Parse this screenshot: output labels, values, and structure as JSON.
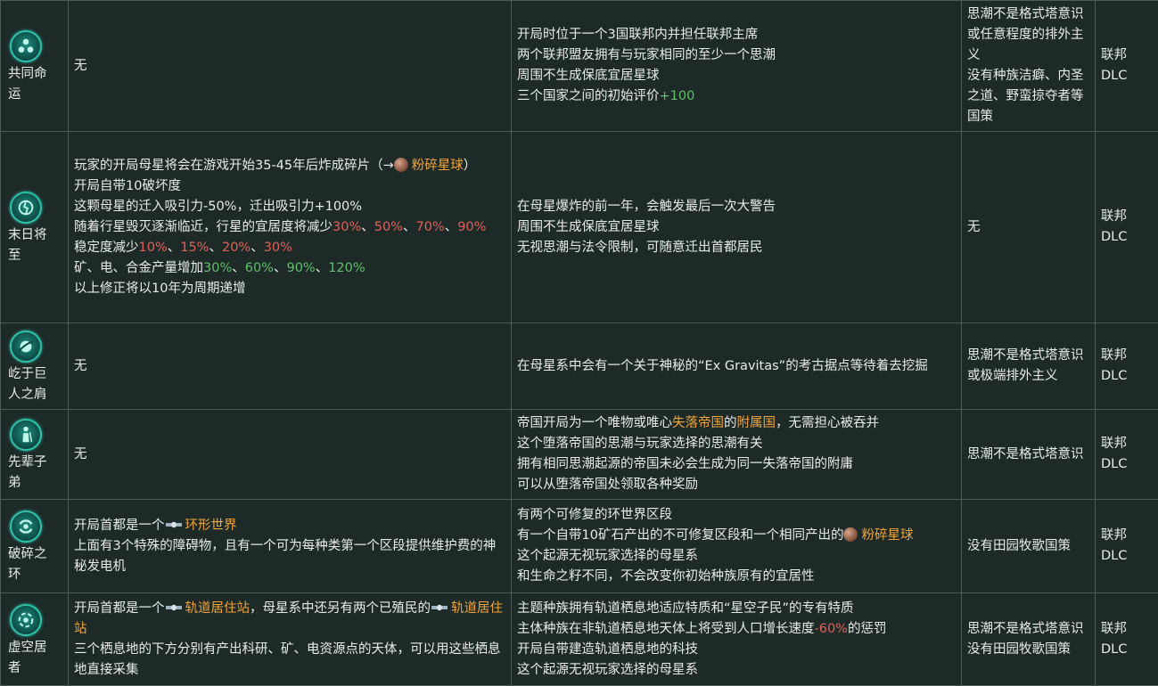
{
  "rows": [
    {
      "name": [
        "共同命",
        "运"
      ],
      "icon": "three-dots-icon",
      "effects": [
        [
          {
            "t": "无"
          }
        ]
      ],
      "details": [
        [
          {
            "t": "开局时位于一个3国联邦内并担任联邦主席"
          }
        ],
        [
          {
            "t": "两个联邦盟友拥有与玩家相同的至少一个思潮"
          }
        ],
        [
          {
            "t": "周围不生成保底宜居星球"
          }
        ],
        [
          {
            "t": "三个国家之间的初始评价"
          },
          {
            "t": "+100",
            "c": "green"
          }
        ]
      ],
      "requirements": [
        "思潮不是格式塔意识或任意程度的排外主义",
        "没有种族洁癖、内圣之道、野蛮掠夺者等国策"
      ],
      "dlc": "联邦DLC"
    },
    {
      "name": [
        "末日将",
        "至"
      ],
      "icon": "doom-planet-icon",
      "effects": [
        [
          {
            "t": "玩家的开局母星将会在游戏开始35-45年后炸成碎片（→"
          },
          {
            "icon": "planet"
          },
          {
            "t": "粉碎星球",
            "c": "orange"
          },
          {
            "t": "）"
          }
        ],
        [
          {
            "t": "开局自带10破坏度"
          }
        ],
        [
          {
            "t": "这颗母星的迁入吸引力-50%，迁出吸引力+100%"
          }
        ],
        [
          {
            "t": "随着行星毁灭逐渐临近，行星的宜居度将减少"
          },
          {
            "t": "30%",
            "c": "red"
          },
          {
            "t": "、"
          },
          {
            "t": "50%",
            "c": "red"
          },
          {
            "t": "、"
          },
          {
            "t": "70%",
            "c": "red"
          },
          {
            "t": "、"
          },
          {
            "t": "90%",
            "c": "red"
          }
        ],
        [
          {
            "t": "稳定度减少"
          },
          {
            "t": "10%",
            "c": "red"
          },
          {
            "t": "、"
          },
          {
            "t": "15%",
            "c": "red"
          },
          {
            "t": "、"
          },
          {
            "t": "20%",
            "c": "red"
          },
          {
            "t": "、"
          },
          {
            "t": "30%",
            "c": "red"
          }
        ],
        [
          {
            "t": "矿、电、合金产量增加"
          },
          {
            "t": "30%",
            "c": "green"
          },
          {
            "t": "、"
          },
          {
            "t": "60%",
            "c": "green"
          },
          {
            "t": "、"
          },
          {
            "t": "90%",
            "c": "green"
          },
          {
            "t": "、"
          },
          {
            "t": "120%",
            "c": "green"
          }
        ],
        [
          {
            "t": "以上修正将以10年为周期递增"
          }
        ]
      ],
      "details": [
        [
          {
            "t": "在母星爆炸的前一年，会触发最后一次大警告"
          }
        ],
        [
          {
            "t": "周围不生成保底宜居星球"
          }
        ],
        [
          {
            "t": "无视思潮与法令限制，可随意迁出首都居民"
          }
        ]
      ],
      "requirements": [
        "无"
      ],
      "dlc": "联邦DLC"
    },
    {
      "name": [
        "屹于巨",
        "人之肩"
      ],
      "icon": "giant-shoulder-icon",
      "effects": [
        [
          {
            "t": "无"
          }
        ]
      ],
      "details": [
        [
          {
            "t": "在母星系中会有一个关于神秘的“Ex Gravitas”的考古据点等待着去挖掘"
          }
        ]
      ],
      "requirements": [
        "思潮不是格式塔意识或极端排外主义"
      ],
      "dlc": "联邦DLC"
    },
    {
      "name": [
        "先辈子",
        "弟"
      ],
      "icon": "elder-figure-icon",
      "effects": [
        [
          {
            "t": "无"
          }
        ]
      ],
      "details": [
        [
          {
            "t": "帝国开局为一个唯物或唯心"
          },
          {
            "t": "失落帝国",
            "c": "orange"
          },
          {
            "t": "的"
          },
          {
            "t": "附属国",
            "c": "orange"
          },
          {
            "t": "，无需担心被吞并"
          }
        ],
        [
          {
            "t": "这个堕落帝国的思潮与玩家选择的思潮有关"
          }
        ],
        [
          {
            "t": "拥有相同思潮起源的帝国未必会生成为同一失落帝国的附庸"
          }
        ],
        [
          {
            "t": "可以从堕落帝国处领取各种奖励"
          }
        ]
      ],
      "requirements": [
        "思潮不是格式塔意识"
      ],
      "dlc": "联邦DLC"
    },
    {
      "name": [
        "破碎之",
        "环"
      ],
      "icon": "broken-ring-icon",
      "effects": [
        [
          {
            "t": "开局首都是一个"
          },
          {
            "icon": "station"
          },
          {
            "t": "环形世界",
            "c": "orange"
          }
        ],
        [
          {
            "t": "上面有3个特殊的障碍物，且有一个可为每种类第一个区段提供维护费的神秘发电机"
          }
        ]
      ],
      "details": [
        [
          {
            "t": "有两个可修复的环世界区段"
          }
        ],
        [
          {
            "t": "有一个自带10矿石产出的不可修复区段和一个相同产出的"
          },
          {
            "icon": "planet"
          },
          {
            "t": "粉碎星球",
            "c": "orange"
          }
        ],
        [
          {
            "t": "这个起源无视玩家选择的母星系"
          }
        ],
        [
          {
            "t": "和生命之籽不同，不会改变你初始种族原有的宜居性"
          }
        ]
      ],
      "requirements": [
        "没有田园牧歌国策"
      ],
      "dlc": "联邦DLC"
    },
    {
      "name": [
        "虚空居",
        "者"
      ],
      "icon": "void-dweller-icon",
      "effects": [
        [
          {
            "t": "开局首都是一个"
          },
          {
            "icon": "station"
          },
          {
            "t": "轨道居住站",
            "c": "orange"
          },
          {
            "t": "，母星系中还另有两个已殖民的"
          },
          {
            "icon": "station"
          },
          {
            "t": "轨道居住站",
            "c": "orange"
          }
        ],
        [
          {
            "t": "三个栖息地的下方分别有产出科研、矿、电资源点的天体，可以用这些栖息地直接采集"
          }
        ]
      ],
      "details": [
        [
          {
            "t": "主题种族拥有轨道栖息地适应特质和“星空子民”的专有特质"
          }
        ],
        [
          {
            "t": "主体种族在非轨道栖息地天体上将受到人口增长速度"
          },
          {
            "t": "-60%",
            "c": "red"
          },
          {
            "t": "的惩罚"
          }
        ],
        [
          {
            "t": "开局自带建造轨道栖息地的科技"
          }
        ],
        [
          {
            "t": "这个起源无视玩家选择的母星系"
          }
        ]
      ],
      "requirements": [
        "思潮不是格式塔意识",
        "没有田园牧歌国策"
      ],
      "dlc": "联邦DLC"
    }
  ],
  "colors": {
    "orange": "#f0a43a",
    "red": "#e0605a",
    "green": "#5fbf6a",
    "icon_accent": "#2fc1aa"
  }
}
